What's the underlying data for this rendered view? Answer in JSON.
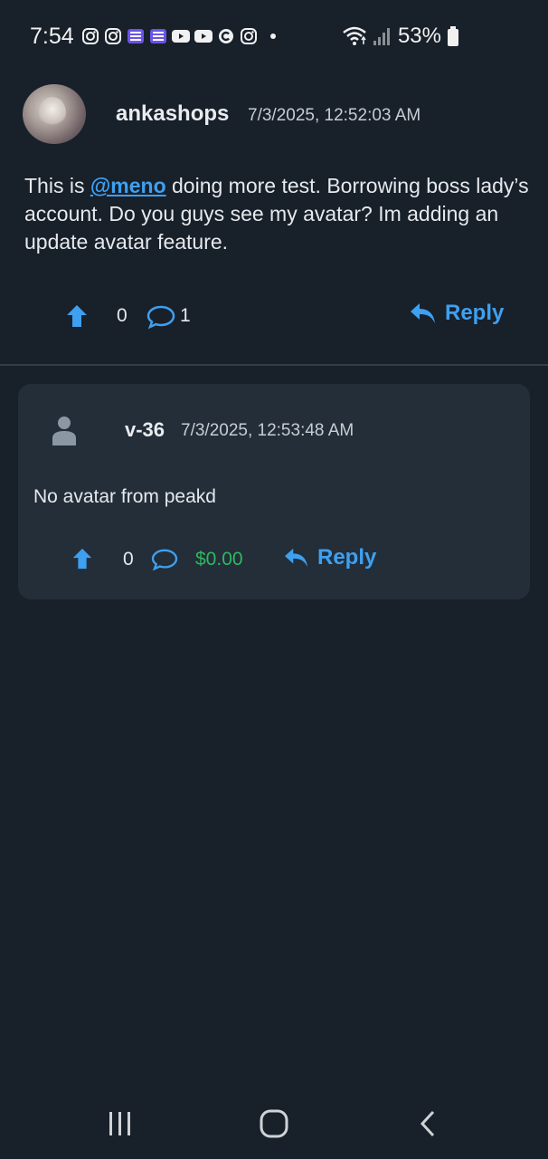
{
  "status_bar": {
    "time": "7:54",
    "battery": "53%",
    "notification_icons": [
      "instagram-icon",
      "instagram-icon",
      "list-app-icon",
      "list-app-icon",
      "youtube-icon",
      "youtube-icon",
      "c-app-icon",
      "instagram-icon"
    ]
  },
  "post": {
    "username": "ankashops",
    "timestamp": "7/3/2025, 12:52:03 AM",
    "body_before": "This is ",
    "mention": "@meno",
    "body_after": " doing more test. Borrowing boss lady’s account.  Do you guys see my avatar? Im adding an update avatar feature.",
    "votes": "0",
    "comments": "1",
    "reply_label": "Reply"
  },
  "reply": {
    "username": "v-36",
    "timestamp": "7/3/2025, 12:53:48 AM",
    "body": "No avatar from peakd",
    "votes": "0",
    "payout": "$0.00",
    "reply_label": "Reply"
  },
  "colors": {
    "background": "#18202a",
    "card": "#232e39",
    "accent": "#3ea0f0",
    "payout": "#2fb85f"
  }
}
